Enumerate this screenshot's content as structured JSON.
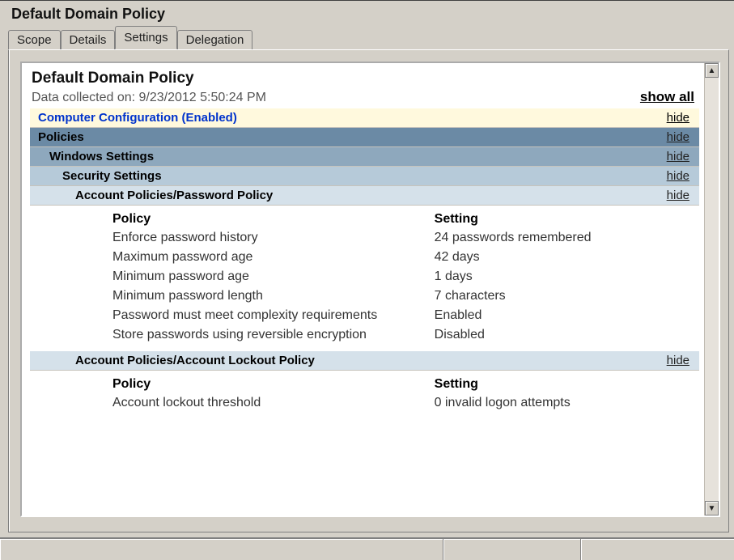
{
  "window": {
    "title": "Default Domain Policy"
  },
  "tabs": [
    "Scope",
    "Details",
    "Settings",
    "Delegation"
  ],
  "active_tab": "Settings",
  "report": {
    "title": "Default Domain Policy",
    "collected_label": "Data collected on: 9/23/2012 5:50:24 PM",
    "show_all": "show all"
  },
  "sections": {
    "computer_config": {
      "label": "Computer Configuration (Enabled)",
      "action": "hide"
    },
    "policies": {
      "label": "Policies",
      "action": "hide"
    },
    "windows_settings": {
      "label": "Windows Settings",
      "action": "hide"
    },
    "security_settings": {
      "label": "Security Settings",
      "action": "hide"
    },
    "password_policy": {
      "label": "Account Policies/Password Policy",
      "action": "hide"
    },
    "lockout_policy": {
      "label": "Account Policies/Account Lockout Policy",
      "action": "hide"
    }
  },
  "headers": {
    "policy": "Policy",
    "setting": "Setting"
  },
  "password_policy_rows": [
    {
      "policy": "Enforce password history",
      "setting": "24 passwords remembered"
    },
    {
      "policy": "Maximum password age",
      "setting": "42 days"
    },
    {
      "policy": "Minimum password age",
      "setting": "1 days"
    },
    {
      "policy": "Minimum password length",
      "setting": "7 characters"
    },
    {
      "policy": "Password must meet complexity requirements",
      "setting": "Enabled"
    },
    {
      "policy": "Store passwords using reversible encryption",
      "setting": "Disabled"
    }
  ],
  "lockout_policy_rows": [
    {
      "policy": "Account lockout threshold",
      "setting": "0 invalid logon attempts"
    }
  ]
}
